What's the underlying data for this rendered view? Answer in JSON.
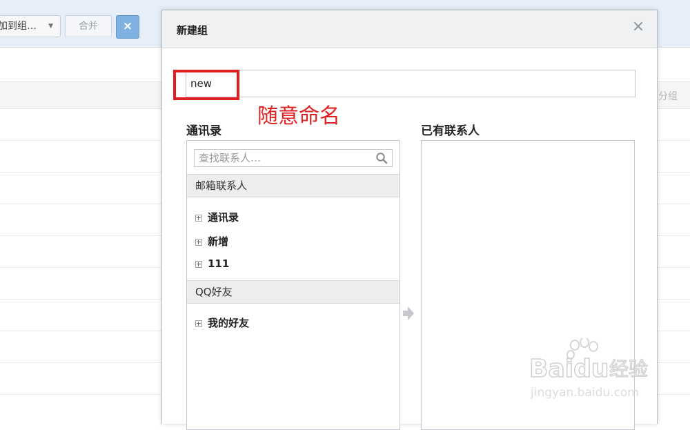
{
  "toolbar": {
    "add_to_group_label": "加到组…",
    "merge_label": "合并",
    "close_label": "×"
  },
  "list": {
    "column_label": "分组"
  },
  "dialog": {
    "title": "新建组",
    "close_label": "×",
    "name_value": "new",
    "annotation": "随意命名",
    "left_pane": {
      "title": "通讯录",
      "search_placeholder": "查找联系人…",
      "groups": [
        {
          "header": "邮箱联系人",
          "items": [
            "通讯录",
            "新增",
            "111"
          ]
        },
        {
          "header": "QQ好友",
          "items": [
            "我的好友"
          ]
        }
      ]
    },
    "right_pane": {
      "title": "已有联系人"
    }
  },
  "watermark": {
    "brand": "Bai",
    "brand2": "du",
    "suffix": "经验",
    "url": "jingyan.baidu.com"
  },
  "colors": {
    "annotation_red": "#e02020",
    "toolbar_bg": "#e6eef8",
    "close_blue": "#7fb2e0"
  }
}
